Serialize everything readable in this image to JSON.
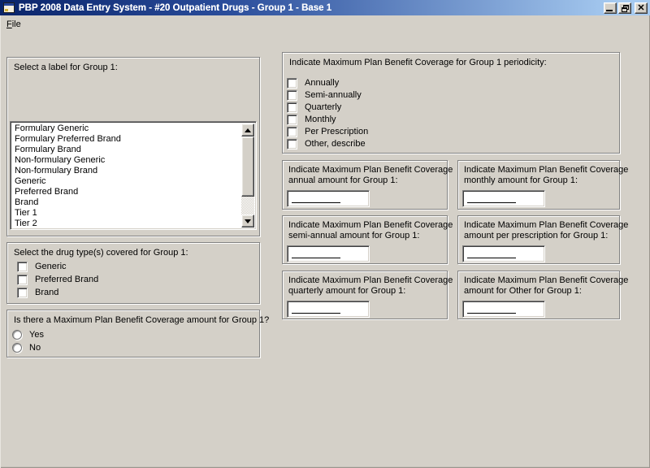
{
  "window": {
    "title": "PBP 2008 Data Entry System - #20 Outpatient Drugs - Group 1 - Base 1"
  },
  "menu": {
    "file_label": "File"
  },
  "icons": {
    "app": "form-window-icon",
    "minimize": "minimize-icon",
    "restore": "restore-window-icon",
    "close": "close-icon",
    "scroll_up": "scroll-up-arrow-icon",
    "scroll_down": "scroll-down-arrow-icon"
  },
  "colors": {
    "titlebar_gradient_left": "#0a246a",
    "titlebar_gradient_right": "#a6caf0",
    "window_background": "#d4d0c8",
    "field_background": "#ffffff",
    "text": "#000000"
  },
  "label_group": {
    "title": "Select a label for Group 1:",
    "options": [
      "Formulary Generic",
      "Formulary Preferred Brand",
      "Formulary Brand",
      "Non-formulary Generic",
      "Non-formulary Brand",
      "Generic",
      "Preferred Brand",
      "Brand",
      "Tier 1",
      "Tier 2"
    ]
  },
  "drug_type_group": {
    "title": "Select the drug type(s) covered for Group 1:",
    "options": [
      "Generic",
      "Preferred Brand",
      "Brand"
    ],
    "checked": [
      false,
      false,
      false
    ]
  },
  "mpb_question_group": {
    "title": "Is there a Maximum Plan Benefit Coverage amount for Group 1?",
    "options": [
      "Yes",
      "No"
    ],
    "selected": null
  },
  "periodicity_group": {
    "title": "Indicate Maximum Plan Benefit Coverage for Group 1 periodicity:",
    "options": [
      "Annually",
      "Semi-annually",
      "Quarterly",
      "Monthly",
      "Per Prescription",
      "Other, describe"
    ],
    "checked": [
      false,
      false,
      false,
      false,
      false,
      false
    ]
  },
  "amount_groups": [
    {
      "line1": "Indicate Maximum Plan Benefit Coverage",
      "line2": "annual amount for Group 1:",
      "value": ""
    },
    {
      "line1": "Indicate Maximum Plan Benefit Coverage",
      "line2": "monthly amount for Group 1:",
      "value": ""
    },
    {
      "line1": "Indicate Maximum Plan Benefit Coverage",
      "line2": "semi-annual amount for Group 1:",
      "value": ""
    },
    {
      "line1": "Indicate Maximum Plan Benefit Coverage",
      "line2": "amount per prescription for Group 1:",
      "value": ""
    },
    {
      "line1": "Indicate Maximum Plan Benefit Coverage",
      "line2": "quarterly amount for Group 1:",
      "value": ""
    },
    {
      "line1": "Indicate Maximum Plan Benefit Coverage",
      "line2": "amount for Other for Group 1:",
      "value": ""
    }
  ]
}
